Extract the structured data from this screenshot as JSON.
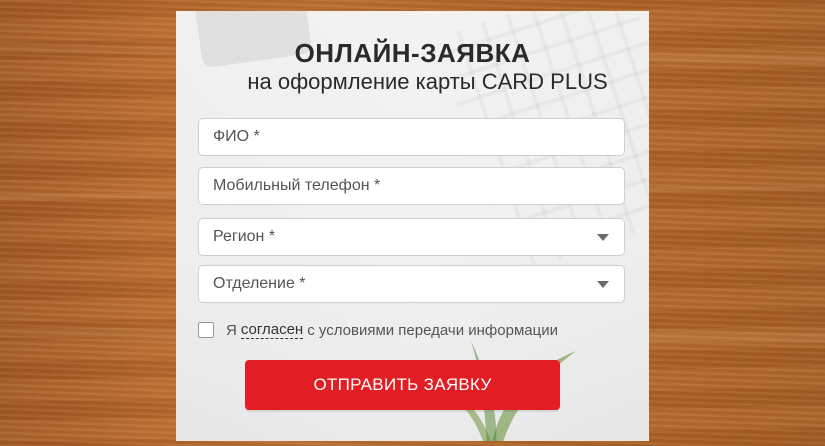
{
  "form": {
    "title": "ОНЛАЙН-ЗАЯВКА",
    "subtitle": "на оформление карты CARD PLUS",
    "fields": {
      "fio_placeholder": "ФИО *",
      "phone_placeholder": "Мобильный телефон *"
    },
    "selects": {
      "region_label": "Регион *",
      "branch_label": "Отделение *"
    },
    "consent": {
      "prefix": "Я",
      "link": "согласен",
      "suffix": "с условиями передачи информации",
      "checked": false
    },
    "submit_label": "ОТПРАВИТЬ ЗАЯВКУ"
  },
  "colors": {
    "accent": "#e21d24",
    "title_text": "#2a2a2a"
  },
  "icons": {
    "select_arrow": "chevron-down-icon"
  }
}
